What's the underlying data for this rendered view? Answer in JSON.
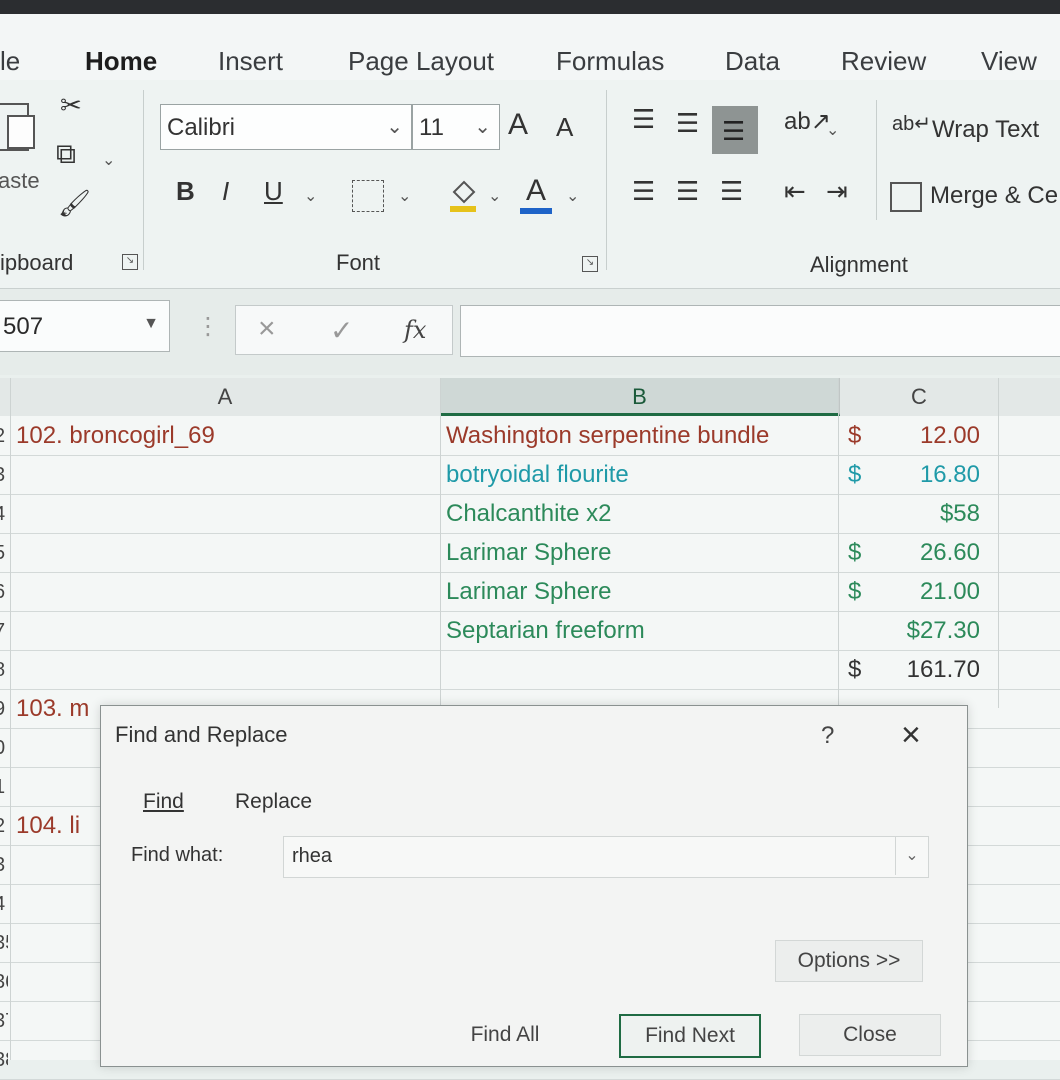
{
  "ribbon": {
    "tabs": [
      "le",
      "Home",
      "Insert",
      "Page Layout",
      "Formulas",
      "Data",
      "Review",
      "View"
    ],
    "active_tab": "Home",
    "groups": {
      "clipboard": "ipboard",
      "font": "Font",
      "alignment": "Alignment"
    },
    "paste_label": "aste",
    "font_name": "Calibri",
    "font_size": "11",
    "bold": "B",
    "italic": "I",
    "underline": "U",
    "grow_font": "A",
    "shrink_font": "A",
    "font_color": "A",
    "wrap_text": "Wrap Text",
    "merge_center": "Merge & Ce",
    "accent_color": "#1f6b43"
  },
  "formula_bar": {
    "name_box": "507",
    "fx": "fx",
    "cancel": "×",
    "enter": "✓",
    "value": ""
  },
  "sheet": {
    "columns": [
      "A",
      "B",
      "C"
    ],
    "selected_column": "B",
    "rows": [
      {
        "num": "2",
        "a": "102. broncogirl_69",
        "b": "Washington serpentine bundle",
        "c_cur": "$",
        "c": "12.00",
        "color": "#9b3a2a"
      },
      {
        "num": "3",
        "a": "",
        "b": "botryoidal flourite",
        "c_cur": "$",
        "c": "16.80",
        "color": "#1f9aa8"
      },
      {
        "num": "4",
        "a": "",
        "b": "Chalcanthite x2",
        "c_cur": "",
        "c": "$58",
        "color": "#2c8a5a"
      },
      {
        "num": "5",
        "a": "",
        "b": "Larimar Sphere",
        "c_cur": "$",
        "c": "26.60",
        "color": "#2c8a5a"
      },
      {
        "num": "6",
        "a": "",
        "b": "Larimar Sphere",
        "c_cur": "$",
        "c": "21.00",
        "color": "#2c8a5a"
      },
      {
        "num": "7",
        "a": "",
        "b": "Septarian freeform",
        "c_cur": "",
        "c": "$27.30",
        "color": "#2c8a5a"
      },
      {
        "num": "8",
        "a": "",
        "b": "",
        "c_cur": "$",
        "c": "161.70",
        "color": "#333333"
      },
      {
        "num": "9",
        "a": "103. m",
        "b": "",
        "c_cur": "",
        "c": "",
        "color": "#9b3a2a"
      },
      {
        "num": "0",
        "a": "",
        "b": "",
        "c_cur": "",
        "c": "",
        "color": "#333333"
      },
      {
        "num": "1",
        "a": "",
        "b": "",
        "c_cur": "",
        "c": "",
        "color": "#333333"
      },
      {
        "num": "2",
        "a": "104. li",
        "b": "",
        "c_cur": "",
        "c": "",
        "color": "#9b3a2a"
      },
      {
        "num": "3",
        "a": "",
        "b": "",
        "c_cur": "",
        "c": "",
        "color": "#333333"
      },
      {
        "num": "4",
        "a": "",
        "b": "",
        "c_cur": "",
        "c": "",
        "color": "#333333"
      },
      {
        "num": "35",
        "a": "",
        "b": "",
        "c_cur": "",
        "c": "",
        "color": "#333333"
      },
      {
        "num": "36",
        "a": "",
        "b": "",
        "c_cur": "",
        "c": "",
        "color": "#333333"
      },
      {
        "num": "37",
        "a": "",
        "b": "",
        "c_cur": "",
        "c": "",
        "color": "#333333"
      },
      {
        "num": "38",
        "a": "",
        "b": "",
        "c_cur": "",
        "c": "",
        "color": "#333333"
      }
    ]
  },
  "dialog": {
    "title": "Find and Replace",
    "help": "?",
    "close": "×",
    "tab_find": "Find",
    "tab_replace": "Replace",
    "find_label": "Find what:",
    "find_value": "rhea",
    "options": "Options >>",
    "find_all": "Find All",
    "find_next": "Find Next",
    "close_button": "Close"
  }
}
